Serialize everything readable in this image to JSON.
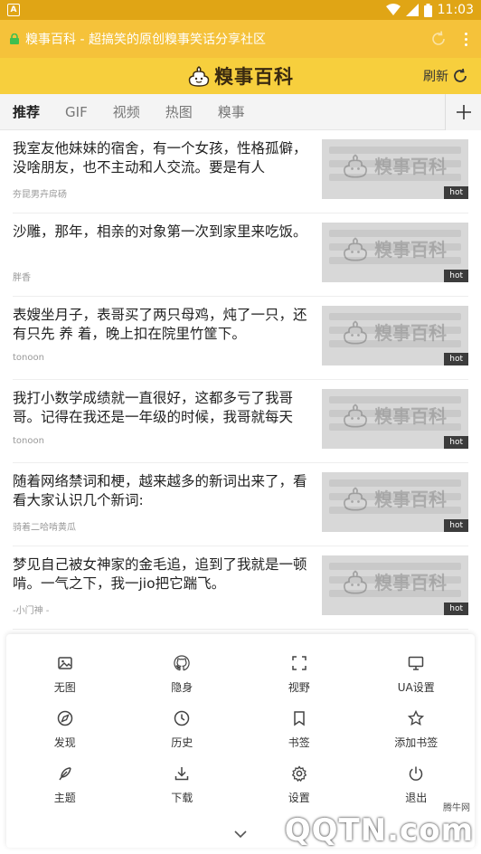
{
  "status_bar": {
    "time": "11:03",
    "left_icon": "A"
  },
  "url_bar": {
    "text": "糗事百科 - 超搞笑的原创糗事笑话分享社区"
  },
  "header": {
    "logo_text": "糗事百科",
    "refresh_label": "刷新"
  },
  "tabs": [
    "推荐",
    "GIF",
    "视频",
    "热图",
    "糗事"
  ],
  "feed": [
    {
      "title": "我室友他妹妹的宿舍，有一个女孩，性格孤僻，没啥朋友，也不主动和人交流。要是有人",
      "author": "夯昆男卉戽砀",
      "badge": "hot"
    },
    {
      "title": "沙雕，那年，相亲的对象第一次到家里来吃饭。",
      "author": "胖香",
      "badge": "hot"
    },
    {
      "title": "表嫂坐月子，表哥买了两只母鸡，炖了一只，还有只先 养 着，晚上扣在院里竹筐下。",
      "author": "tonoon",
      "badge": "hot"
    },
    {
      "title": "我打小数学成绩就一直很好，这都多亏了我哥哥。记得在我还是一年级的时候，我哥就每天",
      "author": "tonoon",
      "badge": "hot"
    },
    {
      "title": "随着网络禁词和梗，越来越多的新词出来了，看看大家认识几个新词:",
      "author": "骑着二哈啃黄瓜",
      "badge": "hot"
    },
    {
      "title": "梦见自己被女神家的金毛追，追到了我就是一顿啃。一气之下，我一jio把它踹飞。",
      "author": "-小门神 -",
      "badge": "hot"
    }
  ],
  "thumb_watermark": "糗事百科",
  "menu": [
    {
      "label": "无图",
      "icon": "image-icon"
    },
    {
      "label": "隐身",
      "icon": "github-icon"
    },
    {
      "label": "视野",
      "icon": "fullscreen-icon"
    },
    {
      "label": "UA设置",
      "icon": "monitor-icon"
    },
    {
      "label": "发现",
      "icon": "compass-icon"
    },
    {
      "label": "历史",
      "icon": "clock-icon"
    },
    {
      "label": "书签",
      "icon": "bookmark-icon"
    },
    {
      "label": "添加书签",
      "icon": "star-icon"
    },
    {
      "label": "主题",
      "icon": "feather-icon"
    },
    {
      "label": "下载",
      "icon": "download-icon"
    },
    {
      "label": "设置",
      "icon": "settings-icon"
    },
    {
      "label": "退出",
      "icon": "power-icon"
    }
  ],
  "site_watermark": {
    "brand": "QQTN.com",
    "small": "腾牛网"
  },
  "colors": {
    "status": "#e0a515",
    "urlbar": "#f5c23a",
    "header": "#f7cf3d"
  }
}
